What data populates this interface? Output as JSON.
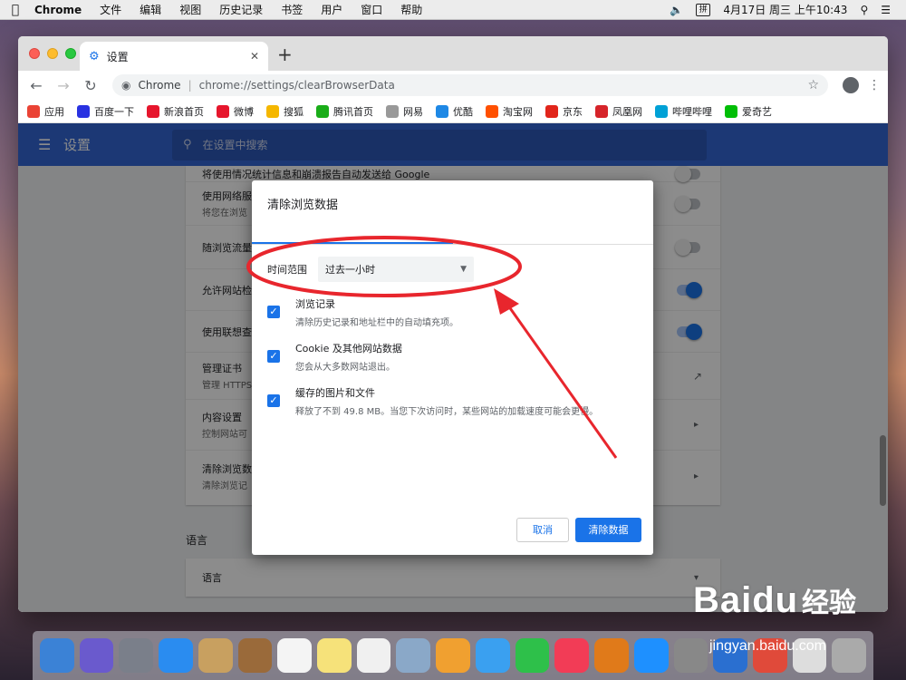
{
  "menubar": {
    "app": "Chrome",
    "items": [
      "文件",
      "编辑",
      "视图",
      "历史记录",
      "书签",
      "用户",
      "窗口",
      "帮助"
    ],
    "ime": "拼",
    "datetime": "4月17日 周三 上午10:43"
  },
  "tab": {
    "title": "设置"
  },
  "omnibox": {
    "brand": "Chrome",
    "url": "chrome://settings/clearBrowserData"
  },
  "bookmarks": [
    {
      "label": "应用",
      "color": "#ea4335"
    },
    {
      "label": "百度一下",
      "color": "#2932e1"
    },
    {
      "label": "新浪首页",
      "color": "#e6162d"
    },
    {
      "label": "微博",
      "color": "#e6162d"
    },
    {
      "label": "搜狐",
      "color": "#f5b700"
    },
    {
      "label": "腾讯首页",
      "color": "#1aad19"
    },
    {
      "label": "网易",
      "color": "#999999"
    },
    {
      "label": "优酷",
      "color": "#1e88e5"
    },
    {
      "label": "淘宝网",
      "color": "#ff5000"
    },
    {
      "label": "京东",
      "color": "#e1251b"
    },
    {
      "label": "凤凰网",
      "color": "#d6242a"
    },
    {
      "label": "哔哩哔哩",
      "color": "#00a1d6"
    },
    {
      "label": "爱奇艺",
      "color": "#00be06"
    }
  ],
  "settings": {
    "title": "设置",
    "search_placeholder": "在设置中搜索",
    "rows": [
      {
        "title": "将使用情况统计信息和崩溃报告自动发送给 Google",
        "sub": "",
        "control": "toggle-off"
      },
      {
        "title": "使用网络服",
        "sub": "将您在浏览",
        "control": "toggle-off"
      },
      {
        "title": "随浏览流量",
        "sub": "",
        "control": "toggle-off"
      },
      {
        "title": "允许网站检",
        "sub": "",
        "control": "toggle-on"
      },
      {
        "title": "使用联想查",
        "sub": "",
        "control": "toggle-on"
      },
      {
        "title": "管理证书",
        "sub": "管理 HTTPS",
        "control": "external"
      },
      {
        "title": "内容设置",
        "sub": "控制网站可",
        "control": "arrow"
      },
      {
        "title": "清除浏览数",
        "sub": "清除浏览记",
        "control": "arrow"
      }
    ],
    "language_heading": "语言",
    "language_row": "语言"
  },
  "dialog": {
    "title": "清除浏览数据",
    "time_range_label": "时间范围",
    "time_range_value": "过去一小时",
    "options": [
      {
        "title": "浏览记录",
        "desc": "清除历史记录和地址栏中的自动填充项。",
        "checked": true
      },
      {
        "title": "Cookie 及其他网站数据",
        "desc": "您会从大多数网站退出。",
        "checked": true
      },
      {
        "title": "缓存的图片和文件",
        "desc": "释放了不到 49.8 MB。当您下次访问时，某些网站的加载速度可能会更慢。",
        "checked": true
      }
    ],
    "cancel_label": "取消",
    "clear_label": "清除数据"
  },
  "watermark": {
    "brand": "Baidu",
    "suffix": "经验",
    "url": "jingyan.baidu.com"
  },
  "colors": {
    "accent": "#1a73e8",
    "header": "#3367d6",
    "annotation": "#e8262d"
  }
}
